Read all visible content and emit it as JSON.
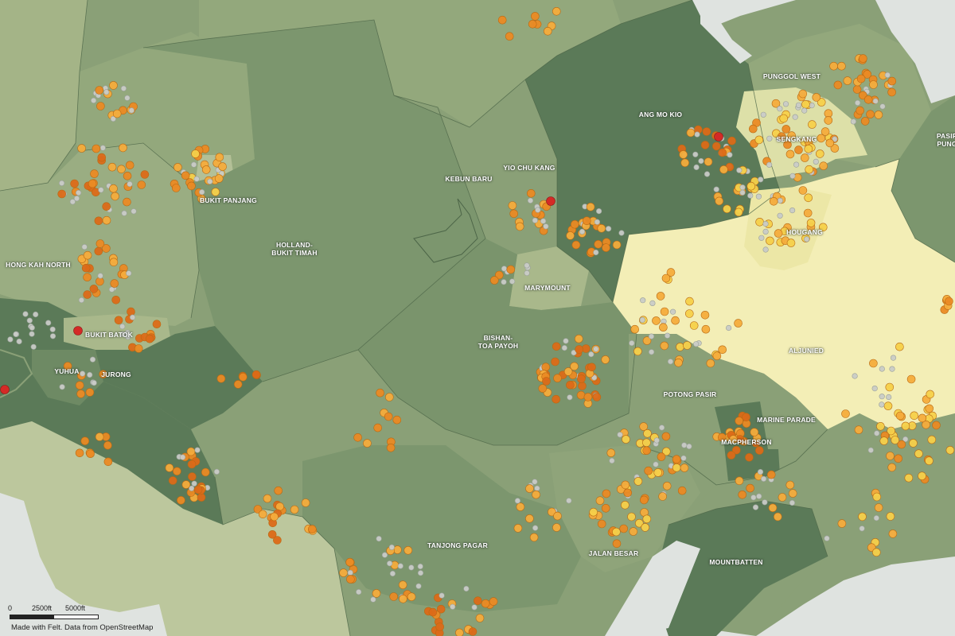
{
  "map": {
    "labels": [
      {
        "text": "HONG KAH NORTH",
        "dark": false
      },
      {
        "text": "BUKIT PANJANG",
        "dark": false
      },
      {
        "text": "HOLLAND-\nBUKIT TIMAH",
        "dark": false
      },
      {
        "text": "KEBUN BARU",
        "dark": false
      },
      {
        "text": "YIO CHU KANG",
        "dark": false
      },
      {
        "text": "ANG MO KIO",
        "dark": false
      },
      {
        "text": "PUNGGOL WEST",
        "dark": false
      },
      {
        "text": "SENGKANG",
        "dark": false
      },
      {
        "text": "PASIR\nPUNG",
        "dark": false
      },
      {
        "text": "HOUGANG",
        "dark": false
      },
      {
        "text": "MARYMOUNT",
        "dark": false
      },
      {
        "text": "BISHAN-\nTOA PAYOH",
        "dark": false
      },
      {
        "text": "ALJUNIED",
        "dark": false
      },
      {
        "text": "BUKIT BATOK",
        "dark": false
      },
      {
        "text": "YUHUA",
        "dark": false
      },
      {
        "text": "JURONG",
        "dark": false
      },
      {
        "text": "POTONG PASIR",
        "dark": false
      },
      {
        "text": "MARINE PARADE",
        "dark": false
      },
      {
        "text": "MACPHERSON",
        "dark": false
      },
      {
        "text": "TANJONG PAGAR",
        "dark": false
      },
      {
        "text": "JALAN BESAR",
        "dark": false
      },
      {
        "text": "MOUNTBATTEN",
        "dark": false
      }
    ],
    "colors": {
      "water": "#dfe3e0",
      "land_light": "#b7c49a",
      "land_mid": "#8aa077",
      "land_mid2": "#7d9570",
      "land_dark": "#62805c",
      "land_darker": "#557454",
      "land_pale": "#ccd2a6",
      "land_yellow": "#f3eeb6",
      "land_yellow2": "#ece7a6",
      "border": "#4d6648",
      "point_gray": "#c9cbc7",
      "point_yellow": "#f5d04a",
      "point_amber": "#f4ac3c",
      "point_orange": "#ea8a24",
      "point_darkorange": "#dc6a18",
      "point_red": "#d42a26"
    }
  },
  "scale": {
    "labels": [
      "0",
      "2500ft",
      "5000ft"
    ]
  },
  "attribution": "Made with Felt. Data from OpenStreetMap"
}
